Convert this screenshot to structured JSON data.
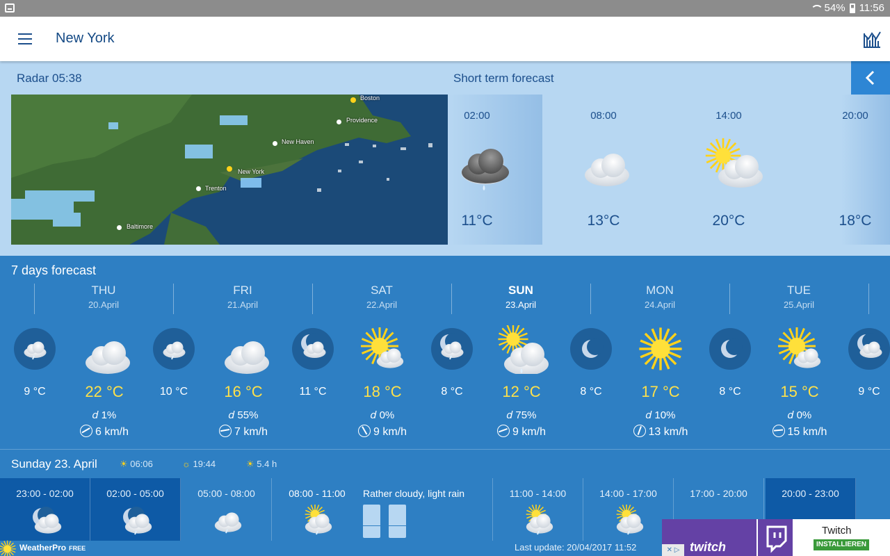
{
  "status_bar": {
    "battery": "54%",
    "time": "11:56"
  },
  "app_bar": {
    "title": "New York"
  },
  "top_panel": {
    "radar_label": "Radar 05:38",
    "short_term_label": "Short term forecast",
    "cities": [
      "Boston",
      "Providence",
      "New Haven",
      "New York",
      "Trenton",
      "Baltimore"
    ],
    "short_term": [
      {
        "time": "02:00",
        "temp": "11°C",
        "icon": "rain-cloud-icon"
      },
      {
        "time": "08:00",
        "temp": "13°C",
        "icon": "cloud-icon"
      },
      {
        "time": "14:00",
        "temp": "20°C",
        "icon": "sun-cloud-icon"
      },
      {
        "time": "20:00",
        "temp": "18°C",
        "icon": "partial-icon"
      }
    ]
  },
  "week": {
    "label": "7 days forecast",
    "days": [
      {
        "name": "THU",
        "date": "20.April",
        "day_temp": "22 °C",
        "rain": "1%",
        "wind": "6 km/h",
        "icon": "cloud-icon"
      },
      {
        "name": "FRI",
        "date": "21.April",
        "day_temp": "16 °C",
        "rain": "55%",
        "wind": "7 km/h",
        "icon": "cloud-icon"
      },
      {
        "name": "SAT",
        "date": "22.April",
        "day_temp": "18 °C",
        "rain": "0%",
        "wind": "9 km/h",
        "icon": "sun-cloud-icon"
      },
      {
        "name": "SUN",
        "date": "23.April",
        "day_temp": "12 °C",
        "rain": "75%",
        "wind": "9 km/h",
        "icon": "sun-rain-cloud-icon"
      },
      {
        "name": "MON",
        "date": "24.April",
        "day_temp": "17 °C",
        "rain": "10%",
        "wind": "13 km/h",
        "icon": "sun-icon"
      },
      {
        "name": "TUE",
        "date": "25.April",
        "day_temp": "15 °C",
        "rain": "0%",
        "wind": "15 km/h",
        "icon": "sun-cloud-icon"
      }
    ],
    "night_temps": [
      "9 °C",
      "10 °C",
      "11 °C",
      "8 °C",
      "8 °C",
      "8 °C",
      "9 °C"
    ]
  },
  "today": {
    "title": "Sunday 23. April",
    "sunrise": "06:06",
    "sunset": "19:44",
    "sunshine": "5.4 h",
    "slots": [
      {
        "time": "23:00 - 02:00"
      },
      {
        "time": "02:00 - 05:00"
      },
      {
        "time": "05:00 - 08:00"
      },
      {
        "time": "08:00 - 11:00"
      },
      {
        "time": "11:00 - 14:00"
      },
      {
        "time": "14:00 - 17:00"
      },
      {
        "time": "17:00 - 20:00"
      },
      {
        "time": "20:00 - 23:00"
      }
    ],
    "description": "Rather cloudy, light rain",
    "last_update": "Last update: 20/04/2017 11:52"
  },
  "logo": {
    "brand": "WeatherPro",
    "edition": "FREE"
  },
  "ad": {
    "brand_word": "twitch",
    "name": "Twitch",
    "install": "INSTALLIEREN"
  },
  "colors": {
    "accent": "#2e7fc3",
    "panel": "#b7d7f2",
    "title": "#154a85",
    "highlight_temp": "#ffe14a"
  }
}
